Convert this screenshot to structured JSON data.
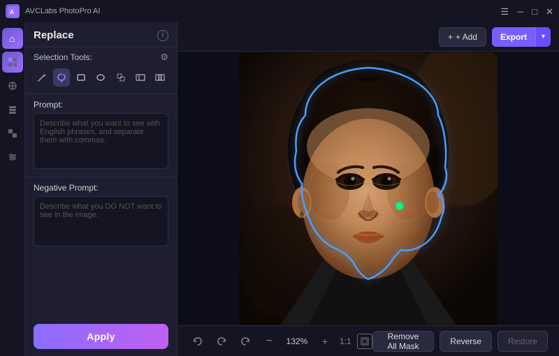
{
  "app": {
    "title": "AVCLabs PhotoPro AI",
    "icon_label": "AVC"
  },
  "window_controls": {
    "menu": "☰",
    "minimize": "─",
    "maximize": "□",
    "close": "✕"
  },
  "header": {
    "add_label": "+ Add",
    "export_label": "Export",
    "export_arrow": "▾"
  },
  "sidebar_icons": [
    {
      "name": "home-icon",
      "symbol": "⌂"
    },
    {
      "name": "tool1-icon",
      "symbol": "❖",
      "active": true
    },
    {
      "name": "tool2-icon",
      "symbol": "✦"
    },
    {
      "name": "tool3-icon",
      "symbol": "⊞"
    },
    {
      "name": "tool4-icon",
      "symbol": "◈"
    },
    {
      "name": "tool5-icon",
      "symbol": "▤"
    }
  ],
  "panel": {
    "title": "Replace",
    "selection_tools_label": "Selection Tools:",
    "tools": [
      {
        "name": "pen-tool",
        "symbol": "✏"
      },
      {
        "name": "lasso-tool",
        "symbol": "⬡",
        "active": true
      },
      {
        "name": "rect-tool",
        "symbol": "▭"
      },
      {
        "name": "ellipse-tool",
        "symbol": "○"
      },
      {
        "name": "magic-tool",
        "symbol": "⬚"
      },
      {
        "name": "subtract-tool",
        "symbol": "⬕"
      },
      {
        "name": "intersect-tool",
        "symbol": "⊟"
      }
    ],
    "prompt_label": "Prompt:",
    "prompt_placeholder": "Describe what you want to see with English phrases, and separate them with commas.",
    "prompt_value": "",
    "negative_prompt_label": "Negative Prompt:",
    "negative_prompt_placeholder": "Describe what you DO NOT want to see in the image.",
    "negative_prompt_value": "",
    "apply_label": "Apply"
  },
  "canvas": {
    "zoom_level": "132%",
    "zoom_ratio": "1:1"
  },
  "bottom_toolbar": {
    "undo_icon": "↺",
    "redo1_icon": "↻",
    "redo2_icon": "↻",
    "minus_icon": "−",
    "plus_icon": "+",
    "remove_mask_label": "Remove All Mask",
    "reverse_label": "Reverse",
    "restore_label": "Restore"
  }
}
